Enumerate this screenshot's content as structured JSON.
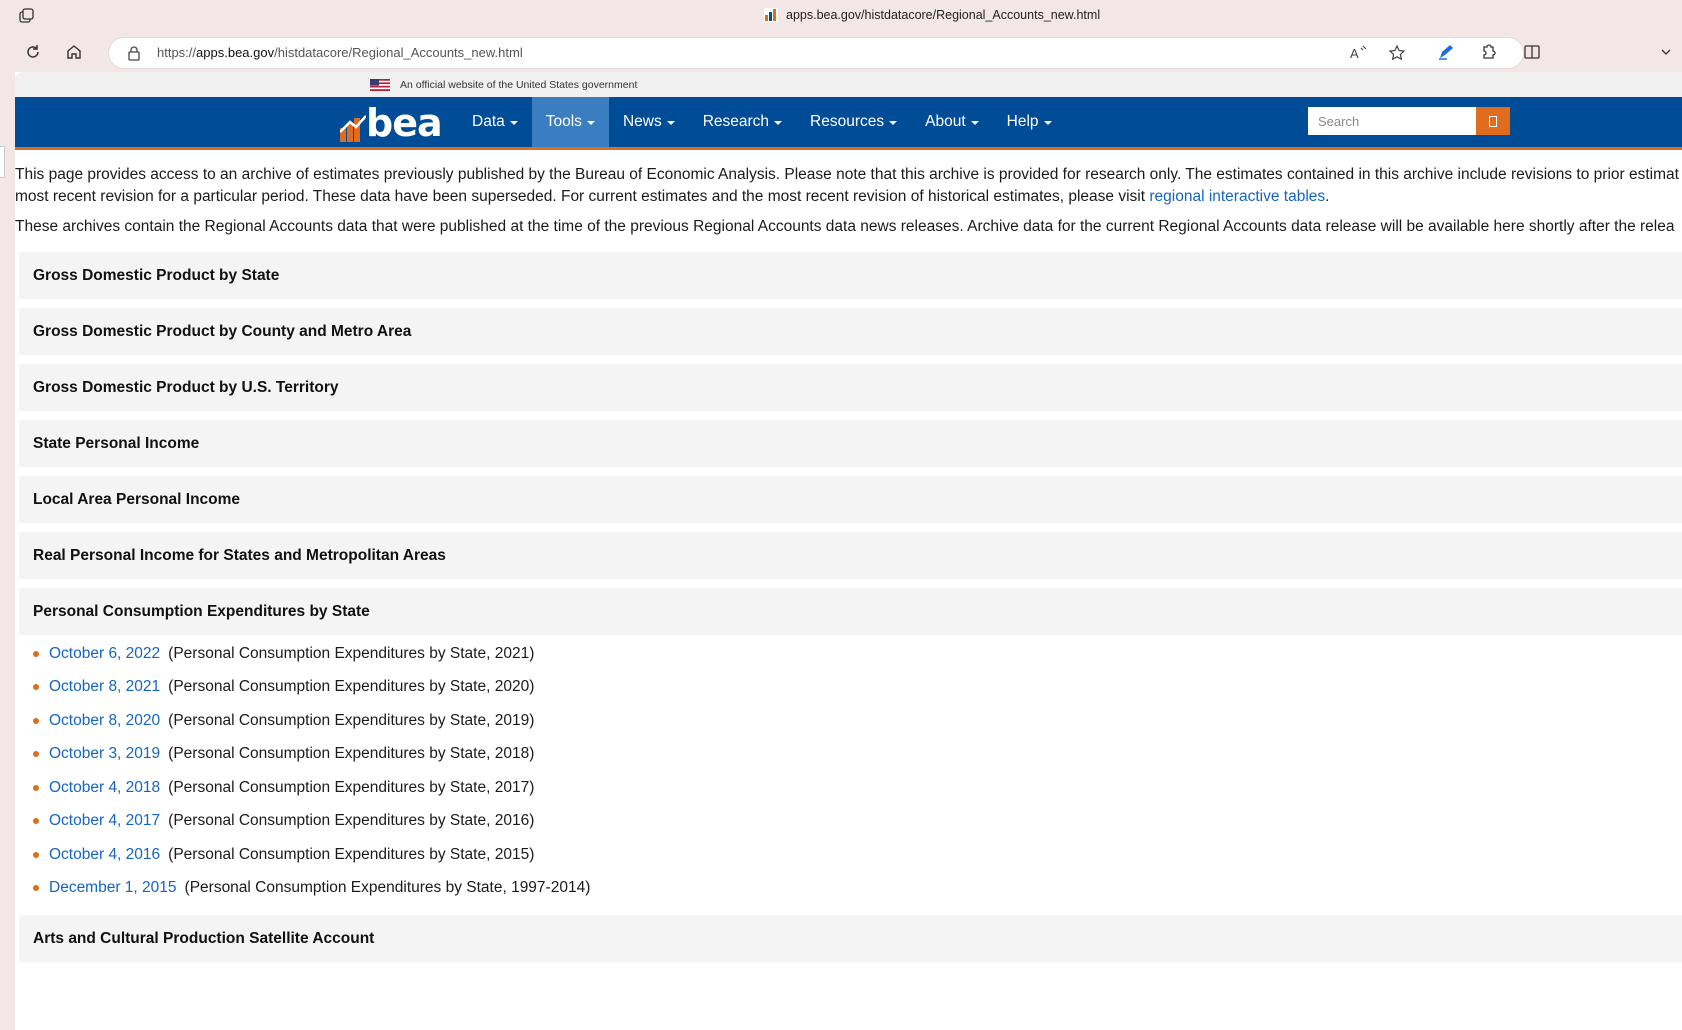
{
  "browser": {
    "tab_title": "apps.bea.gov/histdatacore/Regional_Accounts_new.html",
    "url_scheme": "https://",
    "url_host": "apps.bea.gov",
    "url_path": "/histdatacore/Regional_Accounts_new.html"
  },
  "gov_banner": {
    "text": "An official website of the United States government"
  },
  "navbar": {
    "logo_text": "bea",
    "items": [
      {
        "label": "Data"
      },
      {
        "label": "Tools"
      },
      {
        "label": "News"
      },
      {
        "label": "Research"
      },
      {
        "label": "Resources"
      },
      {
        "label": "About"
      },
      {
        "label": "Help"
      }
    ],
    "active_item": "Tools",
    "search_placeholder": "Search",
    "colors": {
      "bar": "#004c97",
      "accent": "#e06d1f",
      "active": "#3a7dc0"
    }
  },
  "intro": {
    "p1_line1": "This page provides access to an archive of estimates previously published by the Bureau of Economic Analysis. Please note that this archive is provided for research only. The estimates contained in this archive include revisions to prior estimat",
    "p1_line2_before": "most recent revision for a particular period. These data have been superseded. For current estimates and the most recent revision of historical estimates, please visit ",
    "p1_link": "regional interactive tables",
    "p1_line2_after": ".",
    "p2": "These archives contain the Regional Accounts data that were published at the time of the previous Regional Accounts data news releases. Archive data for the current Regional Accounts data release will be available here shortly after the relea"
  },
  "sections": [
    {
      "title": "Gross Domestic Product by State"
    },
    {
      "title": "Gross Domestic Product by County and Metro Area"
    },
    {
      "title": "Gross Domestic Product by U.S. Territory"
    },
    {
      "title": "State Personal Income"
    },
    {
      "title": "Local Area Personal Income"
    },
    {
      "title": "Real Personal Income for States and Metropolitan Areas"
    },
    {
      "title": "Personal Consumption Expenditures by State"
    },
    {
      "title": "Arts and Cultural Production Satellite Account"
    }
  ],
  "pce_releases": [
    {
      "date": "October 6, 2022",
      "desc": "(Personal Consumption Expenditures by State, 2021)"
    },
    {
      "date": "October 8, 2021",
      "desc": "(Personal Consumption Expenditures by State, 2020)"
    },
    {
      "date": "October 8, 2020",
      "desc": "(Personal Consumption Expenditures by State, 2019)"
    },
    {
      "date": "October 3, 2019",
      "desc": "(Personal Consumption Expenditures by State, 2018)"
    },
    {
      "date": "October 4, 2018",
      "desc": "(Personal Consumption Expenditures by State, 2017)"
    },
    {
      "date": "October 4, 2017",
      "desc": "(Personal Consumption Expenditures by State, 2016)"
    },
    {
      "date": "October 4, 2016",
      "desc": "(Personal Consumption Expenditures by State, 2015)"
    },
    {
      "date": "December 1, 2015",
      "desc": "(Personal Consumption Expenditures by State, 1997-2014)"
    }
  ]
}
